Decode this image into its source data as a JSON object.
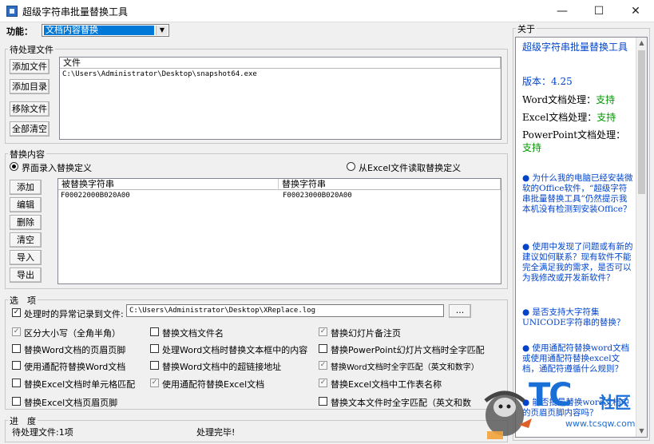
{
  "window": {
    "title": "超级字符串批量替换工具",
    "minimize": "—",
    "maximize": "☐",
    "close": "✕"
  },
  "func": {
    "label": "功能：",
    "value": "文档内容替换"
  },
  "pending": {
    "group_label": "待处理文件",
    "buttons": [
      "添加文件",
      "添加目录",
      "移除文件",
      "全部清空"
    ],
    "column": "文件",
    "files": [
      "C:\\Users\\Administrator\\Desktop\\snapshot64.exe"
    ]
  },
  "replace": {
    "group_label": "替换内容",
    "radio_ui": "界面录入替换定义",
    "radio_excel": "从Excel文件读取替换定义",
    "buttons": [
      "添加",
      "编辑",
      "删除",
      "清空",
      "导入",
      "导出"
    ],
    "col_find": "被替换字符串",
    "col_repl": "替换字符串",
    "rows": [
      {
        "find": "F00022000B020A00",
        "repl": "F00023000B020A00"
      }
    ]
  },
  "options": {
    "group_label": "选　项",
    "log_label": "处理时的异常记录到文件:",
    "log_path": "C:\\Users\\Administrator\\Desktop\\XReplace.log",
    "browse": "...",
    "col1": [
      "区分大小写（全角半角）",
      "替换Word文档的页眉页脚",
      "使用通配符替换Word文档",
      "替换Excel文档时单元格匹配",
      "替换Excel文档页眉页脚"
    ],
    "col2": [
      "替换文档文件名",
      "处理Word文档时替换文本框中的内容",
      "替换Word文档中的超链接地址",
      "使用通配符替换Excel文档"
    ],
    "col3": [
      "替换幻灯片备注页",
      "替换PowerPoint幻灯片文档时全字匹配",
      "替换Word文档时全字匹配（英文和数字）",
      "替换Excel文档中工作表名称",
      "替换文本文件时全字匹配（英文和数"
    ]
  },
  "progress": {
    "group_label": "进　度",
    "pending_text": "待处理文件:1项",
    "status": "处理完毕!"
  },
  "about": {
    "group_label": "关于",
    "app_name": "超级字符串批量替换工具",
    "version_label": "版本：",
    "version": "4.25",
    "word_label": "Word文档处理：",
    "excel_label": "Excel文档处理：",
    "ppt_label": "PowerPoint文档处理：",
    "supported": "支持",
    "faq": [
      "为什么我的电脑已经安装微软的Office软件，“超级字符串批量替换工具”仍然提示我本机没有检测到安装Office？",
      "使用中发现了问题或有新的建议如何联系？现有软件不能完全满足我的需求，是否可以为我修改或开发新软件？",
      "是否支持大字符集UNICODE字符串的替换？",
      "使用通配符替换word文档或使用通配符替换excel文档，通配符遵循什么规则？",
      "能否批量替换word文档中的页眉页脚内容吗？"
    ]
  },
  "watermark": {
    "text_tc": "TC",
    "text_community": "社区",
    "url": "www.tcsqw.com"
  },
  "colors": {
    "link": "#0044cc",
    "green": "#009900",
    "accent": "#0078d7"
  }
}
